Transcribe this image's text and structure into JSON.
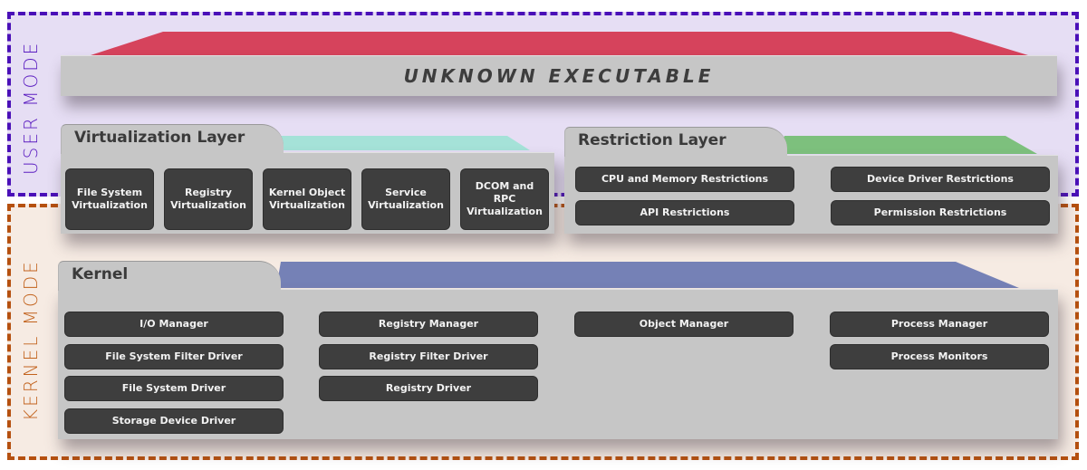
{
  "zones": {
    "user_mode": {
      "label": "USER MODE",
      "border_color": "#4a10b8",
      "fill": "#e6def4"
    },
    "kernel_mode": {
      "label": "KERNEL MODE",
      "border_color": "#b5500f",
      "fill": "#f6ebe3"
    }
  },
  "executable": {
    "title": "UNKNOWN EXECUTABLE",
    "accent": "#d6435c"
  },
  "virtualization_layer": {
    "title": "Virtualization Layer",
    "accent": "#a5e2d8",
    "items": [
      {
        "line1": "File System",
        "line2": "Virtualization"
      },
      {
        "line1": "Registry",
        "line2": "Virtualization"
      },
      {
        "line1": "Kernel Object",
        "line2": "Virtualization"
      },
      {
        "line1": "Service",
        "line2": "Virtualization"
      },
      {
        "line1": "DCOM and RPC",
        "line2": "Virtualization"
      }
    ]
  },
  "restriction_layer": {
    "title": "Restriction Layer",
    "accent": "#7dc07d",
    "items": [
      "CPU and Memory Restrictions",
      "Device Driver Restrictions",
      "API Restrictions",
      "Permission Restrictions"
    ]
  },
  "kernel": {
    "title": "Kernel",
    "accent": "#7581b6",
    "columns": [
      [
        "I/O Manager",
        "File System Filter Driver",
        "File System Driver",
        "Storage Device Driver"
      ],
      [
        "Registry Manager",
        "Registry Filter Driver",
        "Registry Driver"
      ],
      [
        "Object Manager"
      ],
      [
        "Process Manager",
        "Process Monitors"
      ]
    ]
  }
}
